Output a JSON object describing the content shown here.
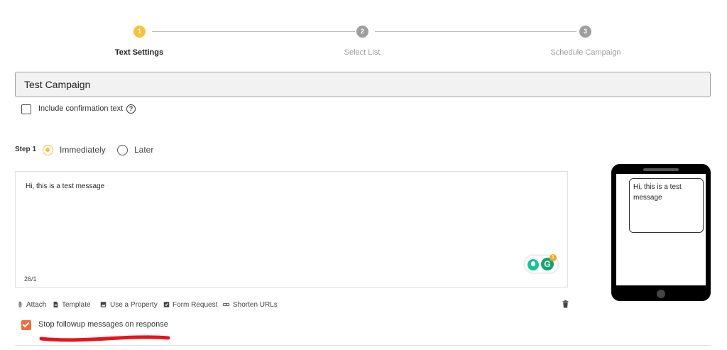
{
  "stepper": {
    "steps": [
      {
        "number": "1",
        "label": "Text Settings",
        "active": true
      },
      {
        "number": "2",
        "label": "Select List",
        "active": false
      },
      {
        "number": "3",
        "label": "Schedule Campaign",
        "active": false
      }
    ]
  },
  "campaign": {
    "title_value": "Test Campaign"
  },
  "confirmation": {
    "label": "Include confirmation text",
    "checked": false,
    "help_icon": "?"
  },
  "step1": {
    "label": "Step 1",
    "options": [
      {
        "label": "Immediately",
        "selected": true
      },
      {
        "label": "Later",
        "selected": false
      }
    ]
  },
  "message": {
    "text": "Hi, this is a test message",
    "char_count": "26/1",
    "grammarly_badge": "1",
    "grammarly_letter": "G"
  },
  "toolbar": {
    "items": [
      {
        "label": "Attach",
        "icon": "paperclip-icon"
      },
      {
        "label": "Template",
        "icon": "document-icon"
      },
      {
        "label": "Use a Property",
        "icon": "image-icon"
      },
      {
        "label": "Form Request",
        "icon": "checkbox-icon"
      },
      {
        "label": "Shorten URLs",
        "icon": "link-icon"
      }
    ],
    "delete_icon": "trash-icon"
  },
  "followup": {
    "label": "Stop followup messages on response",
    "checked": true
  },
  "preview": {
    "bubble_text": "Hi, this is a test message"
  },
  "colors": {
    "active_step": "#f6c23e",
    "inactive_step": "#9e9e9e",
    "checkbox_orange": "#f26b38",
    "annotation_red": "#e8141b",
    "grammarly_green": "#15a373"
  }
}
